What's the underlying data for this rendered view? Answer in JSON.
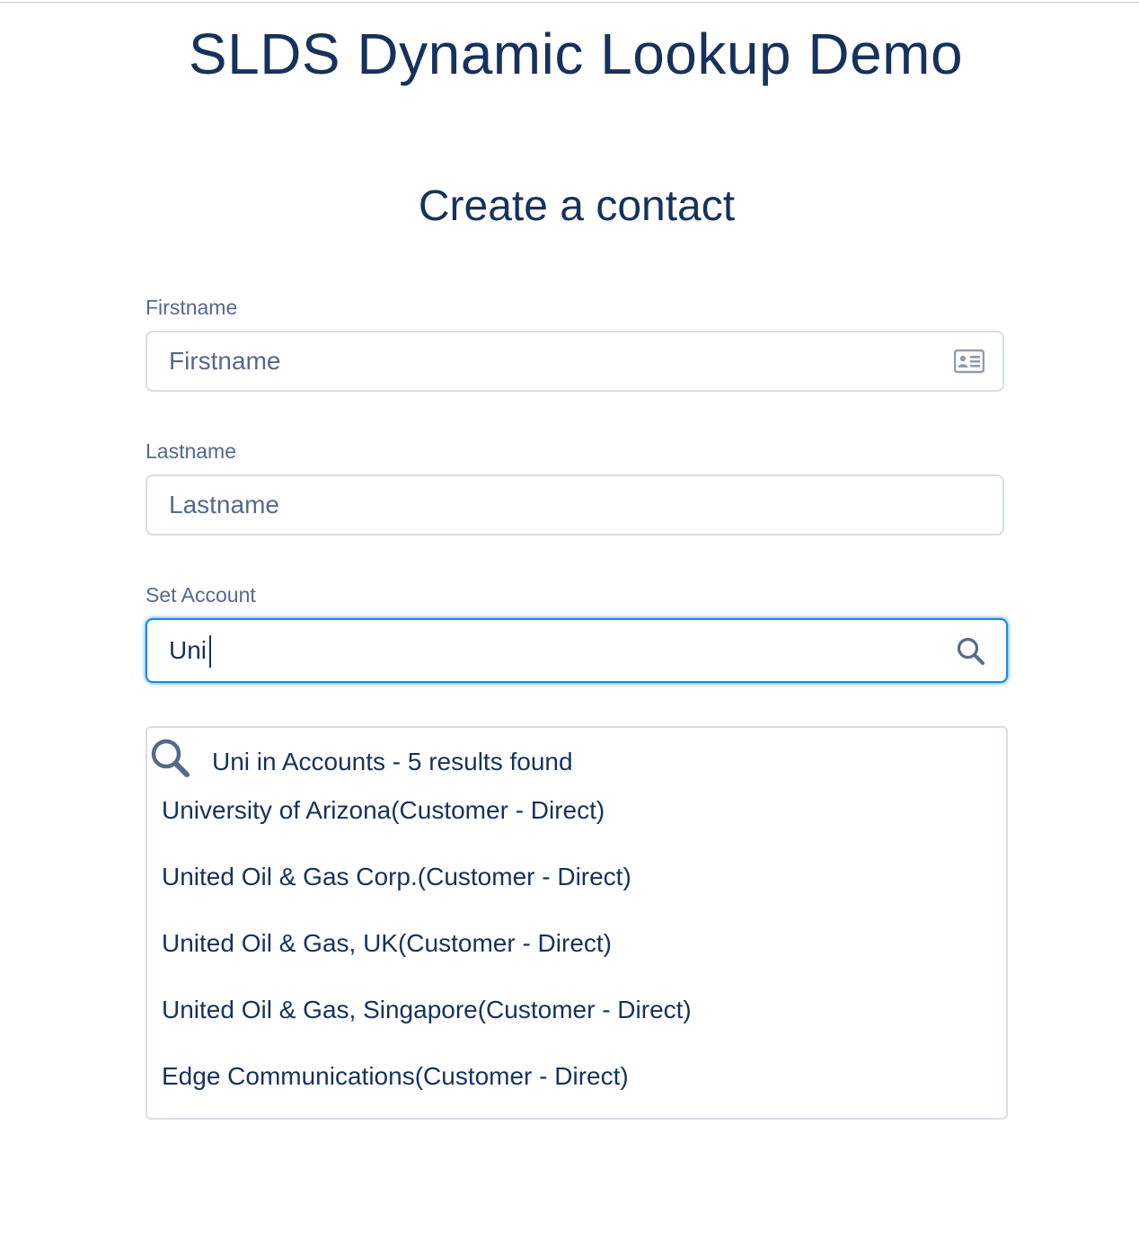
{
  "header": {
    "title": "SLDS Dynamic Lookup Demo"
  },
  "form": {
    "title": "Create a contact",
    "firstname": {
      "label": "Firstname",
      "placeholder": "Firstname",
      "value": "",
      "icon": "contact-card-icon"
    },
    "lastname": {
      "label": "Lastname",
      "placeholder": "Lastname",
      "value": ""
    },
    "account": {
      "label": "Set Account",
      "value": "Uni",
      "icon": "search-icon"
    }
  },
  "lookup": {
    "summary": "Uni in Accounts - 5 results found",
    "results": [
      {
        "label": "University of Arizona(Customer - Direct)"
      },
      {
        "label": "United Oil & Gas Corp.(Customer - Direct)"
      },
      {
        "label": "United Oil & Gas, UK(Customer - Direct)"
      },
      {
        "label": "United Oil & Gas, Singapore(Customer - Direct)"
      },
      {
        "label": "Edge Communications(Customer - Direct)"
      }
    ]
  },
  "colors": {
    "text": "#16325c",
    "label": "#54698d",
    "border": "#d8dde6",
    "focus": "#1589ee"
  }
}
